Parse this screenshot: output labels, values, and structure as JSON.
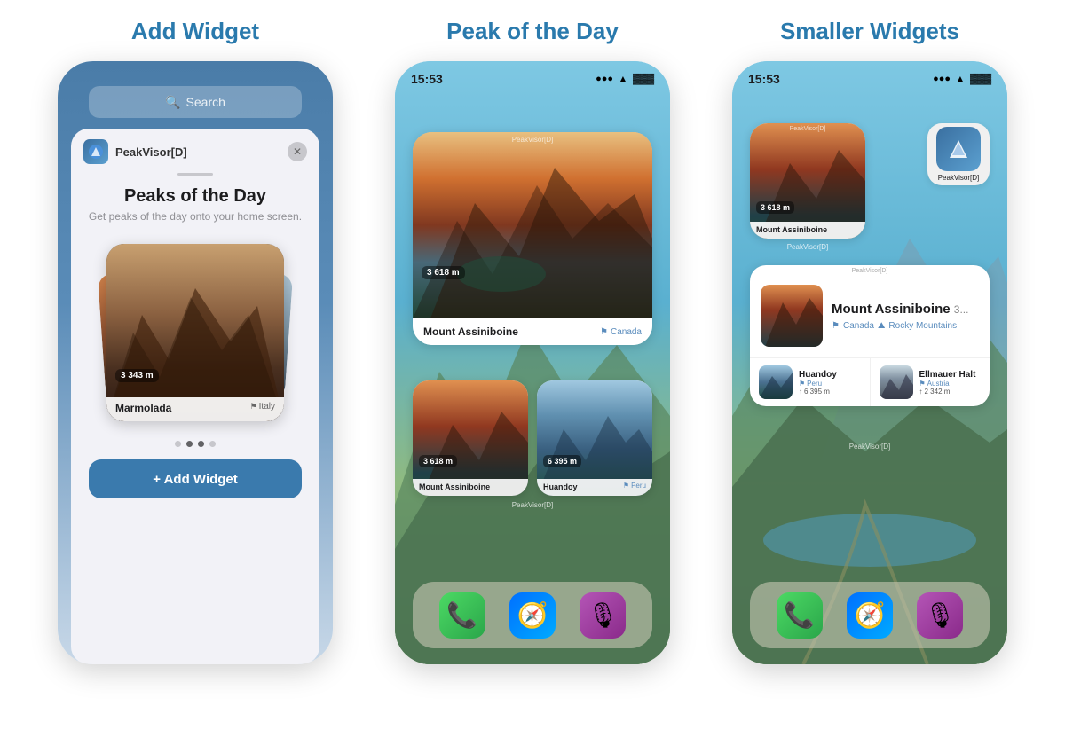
{
  "sections": [
    {
      "id": "add-widget",
      "title": "Add Widget",
      "phone": {
        "searchPlaceholder": "Search",
        "appName": "PeakVisor[D]",
        "panelTitle": "Peaks of the Day",
        "panelSubtitle": "Get peaks of the day onto your home screen.",
        "previewPeak": "Marmolada",
        "previewElevation": "3 343 m",
        "previewCountry": "Italy",
        "addButtonLabel": "+ Add Widget",
        "dots": [
          false,
          true,
          true,
          false
        ]
      }
    },
    {
      "id": "peak-of-the-day",
      "title": "Peak of the Day",
      "phone": {
        "time": "15:53",
        "largeWidget": {
          "peak": "Mount Assiniboine",
          "elevation": "3 618 m",
          "country": "Canada",
          "label": "PeakVisor[D]"
        },
        "smallWidgets": [
          {
            "peak": "Mount Assiniboine",
            "elevation": "3 618 m",
            "country": ""
          },
          {
            "peak": "Huandoy",
            "elevation": "6 395 m",
            "country": "Peru"
          }
        ],
        "smallLabel": "PeakVisor[D]"
      }
    },
    {
      "id": "smaller-widgets",
      "title": "Smaller Widgets",
      "phone": {
        "time": "15:53",
        "smallWidget": {
          "peak": "Mount Assiniboine",
          "elevation": "3 618 m",
          "label": "PeakVisor[D]"
        },
        "appIcon": {
          "name": "PeakVisor[D]"
        },
        "mediumWidget": {
          "mainPeak": "Mount Assiniboine",
          "elevation": "3...",
          "region1": "Canada",
          "region2": "Rocky Mountains",
          "label": "PeakVisor[D]"
        },
        "smallPeaks": [
          {
            "name": "Huandoy",
            "country": "Peru",
            "elevation": "6 395 m"
          },
          {
            "name": "Ellmauer Halt",
            "country": "Austria",
            "elevation": "2 342 m"
          }
        ]
      }
    }
  ],
  "dock": {
    "icons": [
      "📞",
      "🧭",
      "🎙"
    ]
  }
}
